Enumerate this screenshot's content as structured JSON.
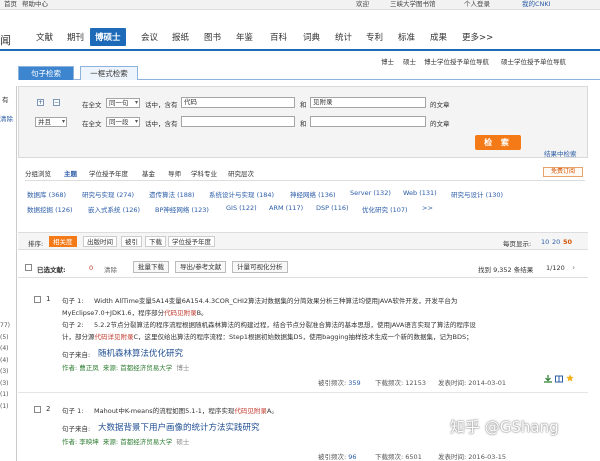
{
  "topbar": {
    "left1": "首页",
    "left2": "帮助中心",
    "welcome": "欢迎",
    "library": "三峡大学图书馆",
    "personal": "个人登录",
    "cnki": "我的CNKI"
  },
  "nav": {
    "logo_fragment": "闻",
    "items": [
      "文献",
      "期刊",
      "博硕士",
      "会议",
      "报纸",
      "图书",
      "年鉴",
      "百科",
      "词典",
      "统计",
      "专利",
      "标准",
      "成果",
      "更多>>"
    ],
    "active_index": 2
  },
  "subnav": [
    "博士",
    "硕士",
    "博士学位授予单位导航",
    "硕士学位授予单位导航"
  ],
  "tabs": {
    "active": "句子检索",
    "inactive": "一框式检索"
  },
  "sidebar": {
    "fragment1": "有",
    "fragment2": "清除"
  },
  "search": {
    "row1": {
      "scope_label": "在全文",
      "mode": "同一句",
      "contains": "话中，含有",
      "term1": "代码",
      "and_label": "和",
      "term2": "见附录",
      "suffix": "的文章"
    },
    "row2": {
      "logic": "并且",
      "scope_label": "在全文",
      "mode": "同一段",
      "contains": "话中，含有",
      "term1": "",
      "and_label": "和",
      "term2": "",
      "suffix": "的文章"
    },
    "button": "检 索",
    "center_link": "结果中检索"
  },
  "grouping": {
    "tabs": [
      "分组浏览",
      "主题",
      "学位授予年度",
      "基金",
      "导师",
      "学科专业",
      "研究层次"
    ],
    "active_tab": "主题",
    "fav_button": "免费订阅",
    "row1": [
      "数据库 (368)",
      "研究与实现 (274)",
      "遗传算法 (188)",
      "系统设计与实现 (184)",
      "神经网络 (136)",
      "Server (132)",
      "Web (131)",
      "研究与设计 (130)"
    ],
    "row2": [
      "数据挖掘 (126)",
      "嵌入式系统 (126)",
      "BP神经网络 (123)",
      "GIS (122)",
      "ARM (117)",
      "DSP (116)",
      "优化研究 (107)",
      ">>"
    ]
  },
  "sortbar": {
    "label": "排序:",
    "options": [
      "相关度",
      "出版时间",
      "被引",
      "下载",
      "学位授予年度"
    ],
    "active": "相关度",
    "per_page_label": "每页显示:",
    "per_page": [
      "10",
      "20",
      "50"
    ]
  },
  "toolbar": {
    "selected_label": "已选文献:",
    "selected_count": "0",
    "clear": "清除",
    "batch": "批量下载",
    "export": "导出/参考文献",
    "visual": "计量可视化分析",
    "found": "找到 9,352 条结果",
    "page": "1/120"
  },
  "results": [
    {
      "num": "1",
      "s1_label": "句子  1:",
      "s1_pre": "Width AllTime变量5A14变量6A154.4.3COR_CHI2算法对数据集的分简效果分析三种算法均使用JAVA软件开发，开发平台为",
      "s1_line2_pre": "MyEclipse7.0+JDK1.6，程序部分",
      "s1_hl": "代码见附录",
      "s1_line2_post": "B。",
      "s2_label": "句子  2:",
      "s2_pre": "5.2.2节点分裂算法的程序流程根据随机森林算法的构建过程，结合节点分裂准合算法的基本思想，使用JAVA语言实现了算法的程序设",
      "s2_line2_pre": "计，部分源",
      "s2_hl": "代码详见附录",
      "s2_line2_post": "C，这里仅给出算法的程序流程：Step1根据初始数据集DS，使用bagging抽样技术生成一个新的数据集，记为BDS；",
      "from_label": "句子来自:",
      "title": "随机森林算法优化研究",
      "author_label": "作者:",
      "author": "曹正凤",
      "source_label": "来源:",
      "source": "首都经济贸易大学",
      "degree": "博士",
      "cited_label": "被引频次:",
      "cited": "359",
      "down_label": "下载频次:",
      "downloads": "12153",
      "date_label": "发表时间:",
      "date": "2014-03-01"
    },
    {
      "num": "2",
      "s1_label": "句子  1:",
      "s1_pre": "Mahout中K-means的流程如图5.1-1，程序实现",
      "s1_hl": "代码见附录",
      "s1_post": "A。",
      "from_label": "句子来自:",
      "title": "大数据背景下用户画像的统计方法实践研究",
      "author_label": "作者:",
      "author": "李映坤",
      "source_label": "来源:",
      "source": "首都经济贸易大学",
      "degree": "硕士",
      "cited_label": "被引频次:",
      "cited": "96",
      "down_label": "下载频次:",
      "downloads": "6501",
      "date_label": "发表时间:",
      "date": "2016-03-15"
    }
  ],
  "left_numbers": [
    "77)",
    "(5)",
    "(4)",
    "(4)",
    "(3)",
    "(3)",
    "(1)",
    "(1)"
  ],
  "watermark": "知乎 @GShang",
  "colors": {
    "brand_blue": "#1d6ab8",
    "accent_orange": "#f47a18",
    "highlight_red": "#c0392b",
    "meta_green": "#2e7d32"
  }
}
